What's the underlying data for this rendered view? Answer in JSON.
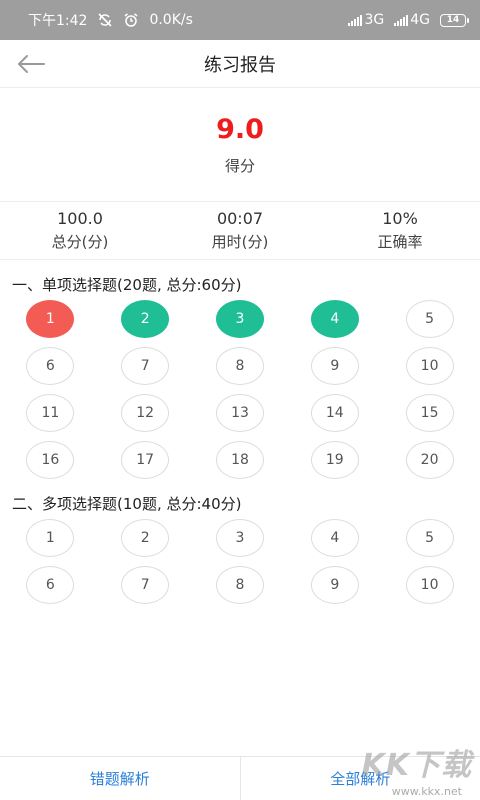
{
  "status": {
    "time": "下午1:42",
    "speed": "0.0K/s",
    "net1": "3G",
    "net2": "4G",
    "battery": "14"
  },
  "header": {
    "title": "练习报告"
  },
  "score": {
    "value": "9.0",
    "label": "得分"
  },
  "stats": [
    {
      "value": "100.0",
      "label": "总分(分)"
    },
    {
      "value": "00:07",
      "label": "用时(分)"
    },
    {
      "value": "10%",
      "label": "正确率"
    }
  ],
  "sections": [
    {
      "title": "一、单项选择题(20题, 总分:60分)",
      "items": [
        {
          "n": "1",
          "s": "wrong"
        },
        {
          "n": "2",
          "s": "right"
        },
        {
          "n": "3",
          "s": "right"
        },
        {
          "n": "4",
          "s": "right"
        },
        {
          "n": "5",
          "s": "none"
        },
        {
          "n": "6",
          "s": "none"
        },
        {
          "n": "7",
          "s": "none"
        },
        {
          "n": "8",
          "s": "none"
        },
        {
          "n": "9",
          "s": "none"
        },
        {
          "n": "10",
          "s": "none"
        },
        {
          "n": "11",
          "s": "none"
        },
        {
          "n": "12",
          "s": "none"
        },
        {
          "n": "13",
          "s": "none"
        },
        {
          "n": "14",
          "s": "none"
        },
        {
          "n": "15",
          "s": "none"
        },
        {
          "n": "16",
          "s": "none"
        },
        {
          "n": "17",
          "s": "none"
        },
        {
          "n": "18",
          "s": "none"
        },
        {
          "n": "19",
          "s": "none"
        },
        {
          "n": "20",
          "s": "none"
        }
      ]
    },
    {
      "title": "二、多项选择题(10题, 总分:40分)",
      "items": [
        {
          "n": "1",
          "s": "none"
        },
        {
          "n": "2",
          "s": "none"
        },
        {
          "n": "3",
          "s": "none"
        },
        {
          "n": "4",
          "s": "none"
        },
        {
          "n": "5",
          "s": "none"
        },
        {
          "n": "6",
          "s": "none"
        },
        {
          "n": "7",
          "s": "none"
        },
        {
          "n": "8",
          "s": "none"
        },
        {
          "n": "9",
          "s": "none"
        },
        {
          "n": "10",
          "s": "none"
        }
      ]
    }
  ],
  "footer": {
    "wrong_analysis": "错题解析",
    "all_analysis": "全部解析"
  },
  "watermark": {
    "main": "KK下载",
    "sub": "www.kkx.net"
  },
  "colors": {
    "wrong": "#f25c55",
    "right": "#1fbe95",
    "score": "#ee1c1c",
    "link": "#2b7fd8"
  }
}
